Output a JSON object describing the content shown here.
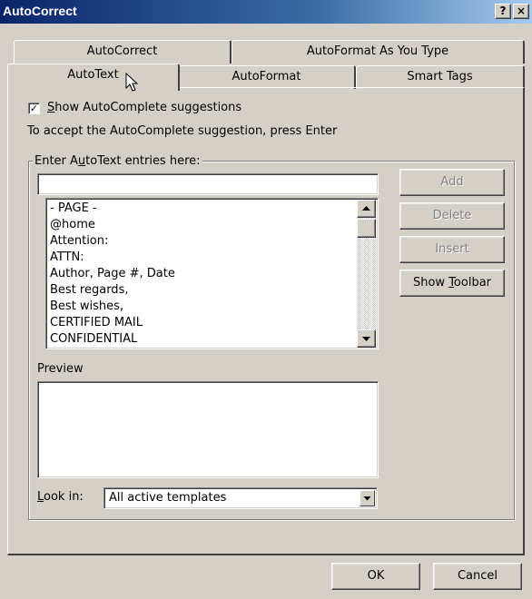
{
  "window": {
    "title": "AutoCorrect",
    "help_button": "?",
    "close_button": "×"
  },
  "tabs": {
    "back_row": [
      "AutoCorrect",
      "AutoFormat As You Type"
    ],
    "front_row": [
      "AutoText",
      "AutoFormat",
      "Smart Tags"
    ],
    "active": "AutoText"
  },
  "autocomplete": {
    "checked": true,
    "label_mnemonic": "S",
    "label_rest": "how AutoComplete suggestions",
    "hint": "To accept the AutoComplete suggestion, press Enter"
  },
  "group": {
    "legend_a": "Enter A",
    "legend_mnemonic": "u",
    "legend_b": "toText entries here:"
  },
  "entry": {
    "value": ""
  },
  "entries": [
    "- PAGE -",
    "@home",
    "Attention:",
    "ATTN:",
    "Author, Page #, Date",
    "Best regards,",
    "Best wishes,",
    "CERTIFIED MAIL",
    "CONFIDENTIAL"
  ],
  "buttons": {
    "add": "Add",
    "delete": "Delete",
    "insert": "Insert",
    "show_toolbar_a": "Show ",
    "show_toolbar_mnemonic": "T",
    "show_toolbar_b": "oolbar",
    "ok": "OK",
    "cancel": "Cancel"
  },
  "preview": {
    "label": "Preview"
  },
  "look_in": {
    "label_mnemonic": "L",
    "label_rest": "ook in:",
    "selected": "All active templates"
  }
}
